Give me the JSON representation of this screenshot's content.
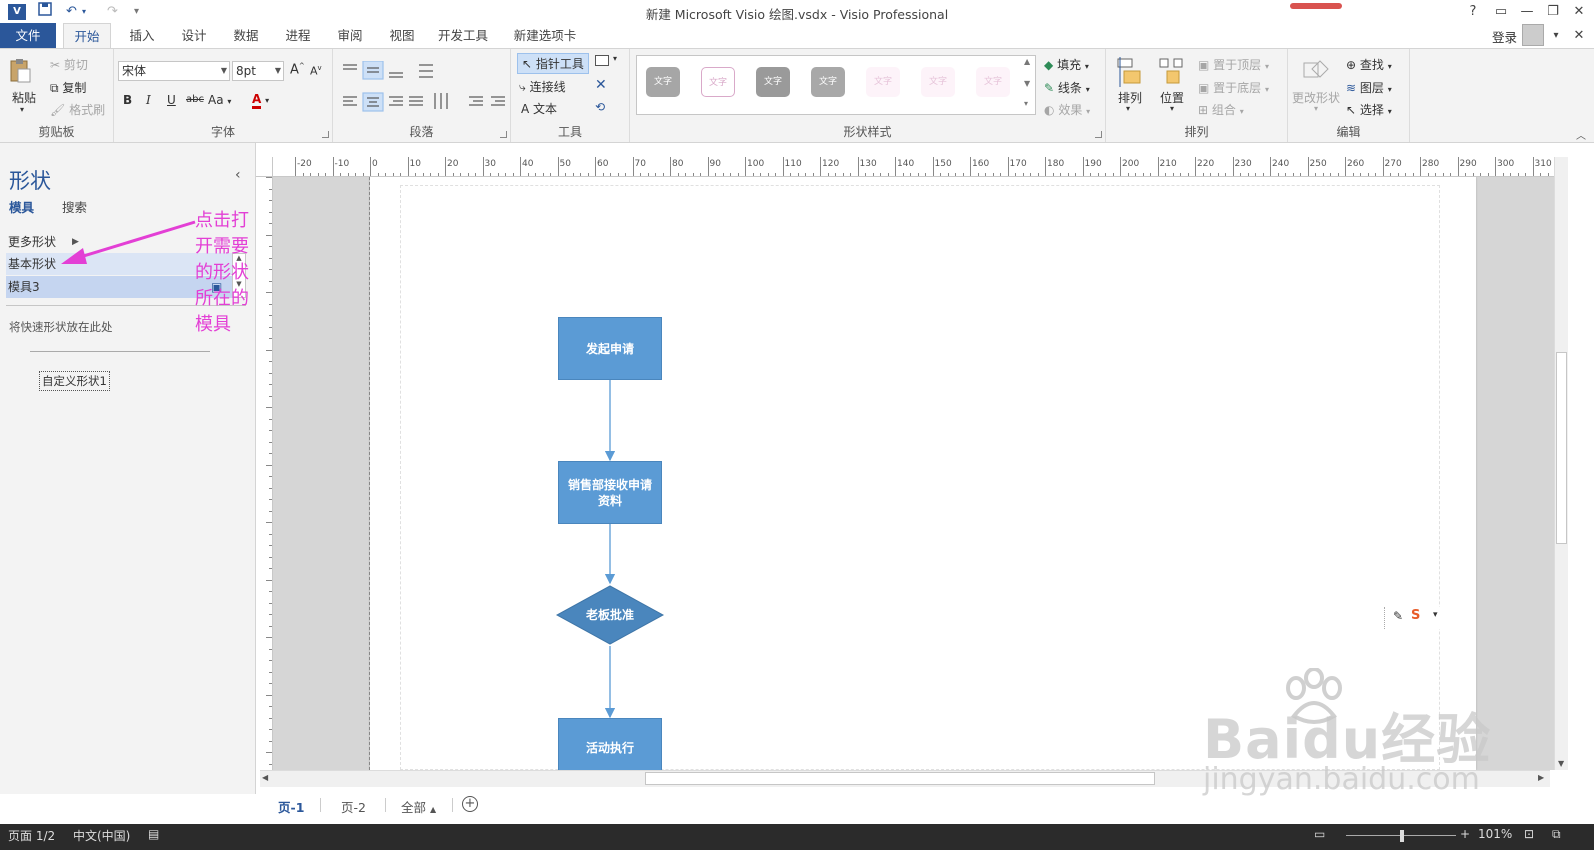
{
  "window": {
    "title": "新建 Microsoft Visio 绘图.vsdx - Visio Professional",
    "help": "?",
    "login": "登录"
  },
  "tabs": [
    {
      "label": "文件"
    },
    {
      "label": "开始"
    },
    {
      "label": "插入"
    },
    {
      "label": "设计"
    },
    {
      "label": "数据"
    },
    {
      "label": "进程"
    },
    {
      "label": "审阅"
    },
    {
      "label": "视图"
    },
    {
      "label": "开发工具"
    },
    {
      "label": "新建选项卡"
    }
  ],
  "ribbon": {
    "clipboard": {
      "label": "剪贴板",
      "paste": "粘贴",
      "cut": "剪切",
      "copy": "复制",
      "format_painter": "格式刷"
    },
    "font": {
      "label": "字体",
      "family": "宋体",
      "size": "8pt",
      "bold": "B",
      "italic": "I",
      "underline": "U",
      "strike": "abc",
      "case": "Aa",
      "color": "A"
    },
    "paragraph": {
      "label": "段落"
    },
    "tools": {
      "label": "工具",
      "pointer": "指针工具",
      "connector": "连接线",
      "text": "文本",
      "text_glyph": "A"
    },
    "shape_styles": {
      "label": "形状样式",
      "swatch_text": "文字",
      "fill": "填充",
      "line": "线条",
      "effect": "效果"
    },
    "arrange": {
      "label": "排列",
      "arrange": "排列",
      "position": "位置",
      "bring_front": "置于顶层",
      "send_back": "置于底层",
      "group": "组合"
    },
    "editing": {
      "label": "编辑",
      "change_shape": "更改形状",
      "find": "查找",
      "layers": "图层",
      "select": "选择"
    }
  },
  "shapes_panel": {
    "title": "形状",
    "tab_stencils": "模具",
    "tab_search": "搜索",
    "more_shapes": "更多形状",
    "stencils": [
      "基本形状",
      "模具3"
    ],
    "quick_hint": "将快速形状放在此处",
    "custom_shape": "自定义形状1",
    "annotation": "点击打开需要的形状所在的模具"
  },
  "flowchart": {
    "nodes": [
      {
        "label": "发起申请",
        "shape": "rect"
      },
      {
        "label": "销售部接收申请资料",
        "shape": "rect"
      },
      {
        "label": "老板批准",
        "shape": "diamond"
      },
      {
        "label": "活动执行",
        "shape": "rect"
      }
    ]
  },
  "page_tabs": {
    "tabs": [
      "页-1",
      "页-2"
    ],
    "all": "全部"
  },
  "status": {
    "page": "页面 1/2",
    "language": "中文(中国)",
    "zoom": "101%"
  },
  "watermark": {
    "brand": "Baidu经验",
    "url": "jingyan.baidu.com"
  },
  "colors": {
    "accent": "#2b579a",
    "shape_fill": "#5b9bd5",
    "annotation": "#e33fd5"
  }
}
